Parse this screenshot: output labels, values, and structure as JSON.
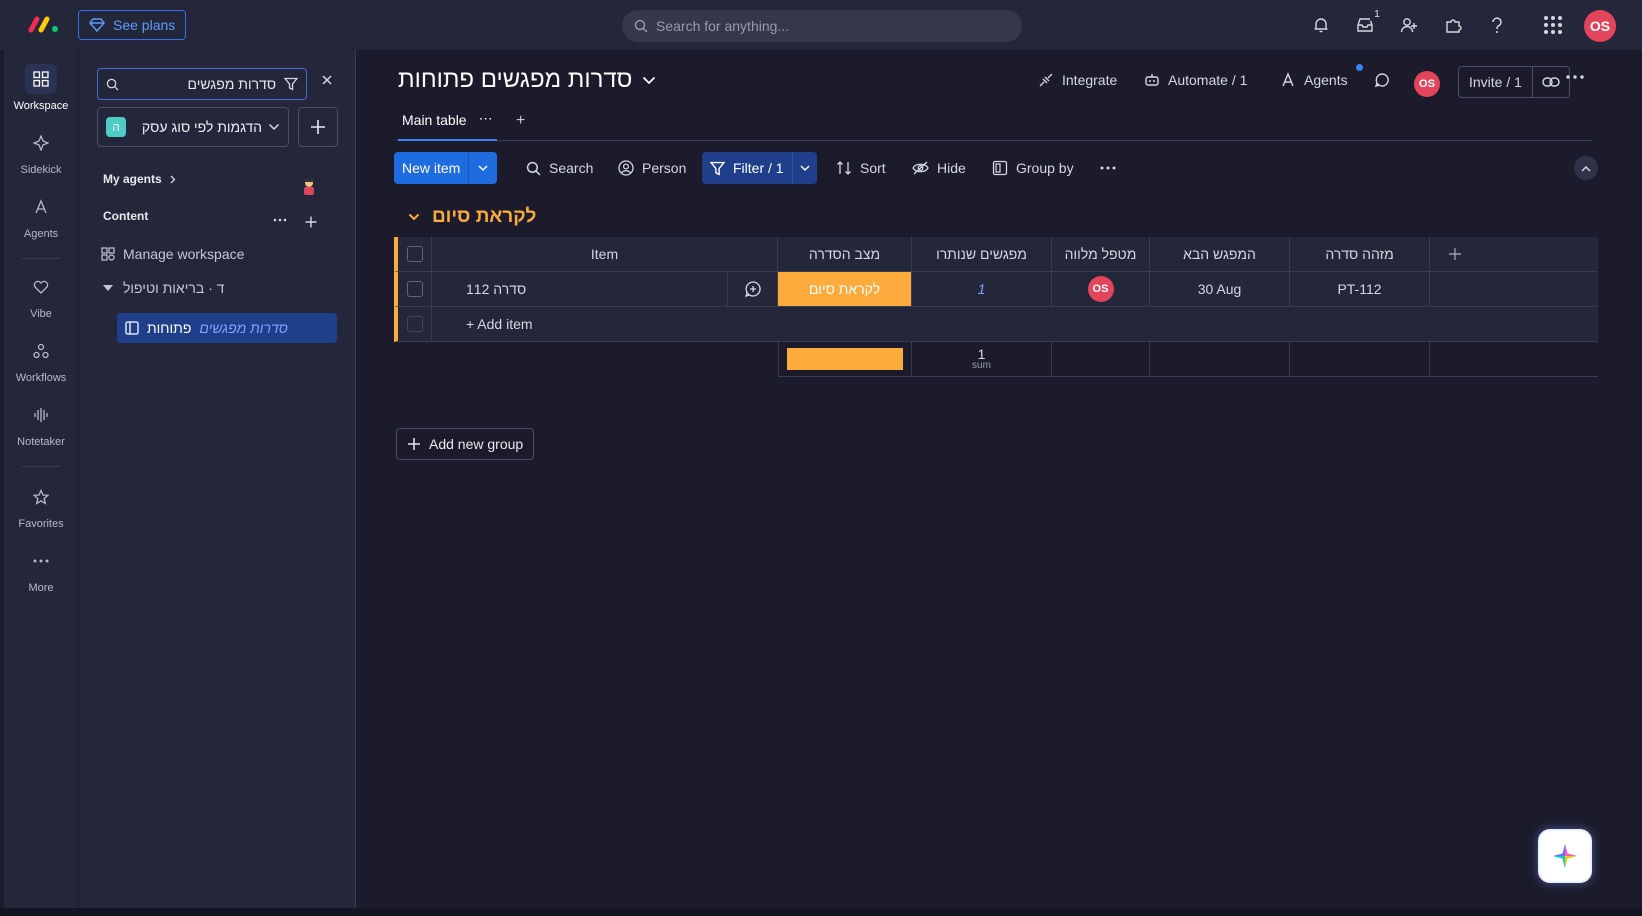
{
  "colors": {
    "accent": "#1f6ce0",
    "group": "#fdab3d",
    "status_working": "#fdab3d",
    "avatar": "#e2445c",
    "background": "#1b1b2b",
    "panel": "#24263a"
  },
  "topbar": {
    "see_plans_label": "See plans",
    "search_placeholder": "Search for anything...",
    "inbox_badge": "1",
    "avatar_initials": "OS",
    "icons": [
      "bell-icon",
      "inbox-icon",
      "invite-members-icon",
      "apps-icon",
      "help-icon",
      "grid-icon"
    ]
  },
  "rail": {
    "items": [
      {
        "label": "Workspace",
        "icon": "workspace-grid-icon"
      },
      {
        "label": "Sidekick",
        "icon": "sparkle-icon"
      },
      {
        "label": "Agents",
        "icon": "agents-icon"
      },
      {
        "label": "Vibe",
        "icon": "heart-icon"
      },
      {
        "label": "Workflows",
        "icon": "workflows-icon"
      },
      {
        "label": "Notetaker",
        "icon": "audio-wave-icon"
      },
      {
        "label": "Favorites",
        "icon": "star-icon"
      },
      {
        "label": "More",
        "icon": "more-dots-icon"
      }
    ]
  },
  "sidebar": {
    "search_value": "סדרות מפגשים",
    "workspace_letter": "ה",
    "workspace_name": "הדגמות לפי סוג עסק",
    "my_agents_label": "My agents",
    "content_label": "Content",
    "manage_workspace_label": "Manage workspace",
    "folder_label": "ד · בריאות וטיפול",
    "board_highlight": "סדרות מפגשים",
    "board_rest": "פתוחות"
  },
  "board": {
    "title": "סדרות מפגשים פתוחות",
    "actions": {
      "integrate": "Integrate",
      "automate": "Automate / 1",
      "agents": "Agents",
      "invite": "Invite / 1",
      "avatar": "OS"
    },
    "tabs": [
      {
        "label": "Main table"
      }
    ],
    "toolbar": {
      "new_item": "New item",
      "search": "Search",
      "person": "Person",
      "filter": "Filter / 1",
      "sort": "Sort",
      "hide": "Hide",
      "group_by": "Group by"
    }
  },
  "group": {
    "title": "לקראת סיום",
    "columns": [
      "Item",
      "מצב הסדרה",
      "מפגשים שנותרו",
      "מטפל מלווה",
      "המפגש הבא",
      "מזהה סדרה"
    ],
    "rows": [
      {
        "item": "סדרה 112",
        "status": "לקראת סיום",
        "remaining": "1",
        "owner": "OS",
        "next": "30 Aug",
        "series_id": "PT-112"
      }
    ],
    "add_item": "+ Add item",
    "summary": {
      "sum_value": "1",
      "sum_label": "sum",
      "status_fraction_working": 1.0
    }
  },
  "add_new_group": "Add new group"
}
